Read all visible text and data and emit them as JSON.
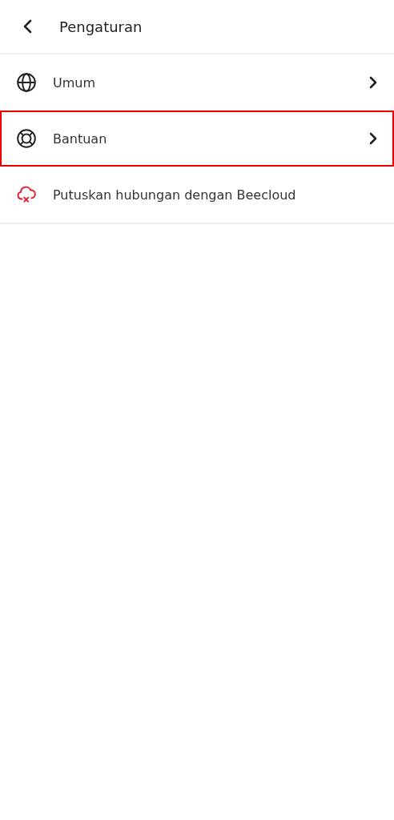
{
  "header": {
    "title": "Pengaturan"
  },
  "items": [
    {
      "label": "Umum",
      "kind": "general",
      "highlighted": false
    },
    {
      "label": "Bantuan",
      "kind": "help",
      "highlighted": true
    },
    {
      "label": "Putuskan hubungan dengan Beecloud",
      "kind": "disconnect",
      "highlighted": false
    }
  ]
}
